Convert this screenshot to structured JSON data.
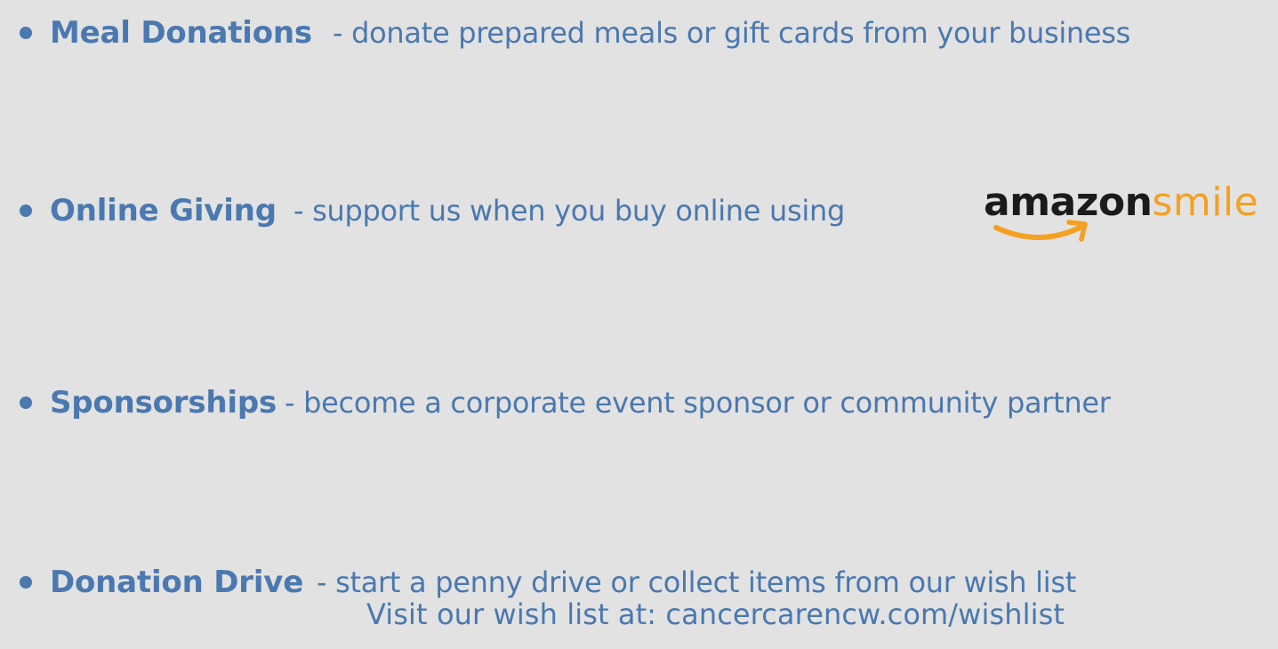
{
  "items": [
    {
      "term": "Meal Donations",
      "desc": "- donate prepared meals or gift cards from your business"
    },
    {
      "term": "Online Giving",
      "desc": "- support us when you buy online using"
    },
    {
      "term": "Sponsorships",
      "desc": "- become a corporate event sponsor or community partner"
    },
    {
      "term": "Donation Drive",
      "desc": "-  start a penny drive or collect items from our wish list"
    }
  ],
  "wishlist_line": "Visit our wish list at: cancercarencw.com/wishlist",
  "logo": {
    "part1": "amazon",
    "part2": "smile"
  },
  "colors": {
    "background": "#e2e2e2",
    "text": "#4a78b0",
    "amazon_dark": "#1b1b1b",
    "amazon_orange": "#f4a021"
  }
}
